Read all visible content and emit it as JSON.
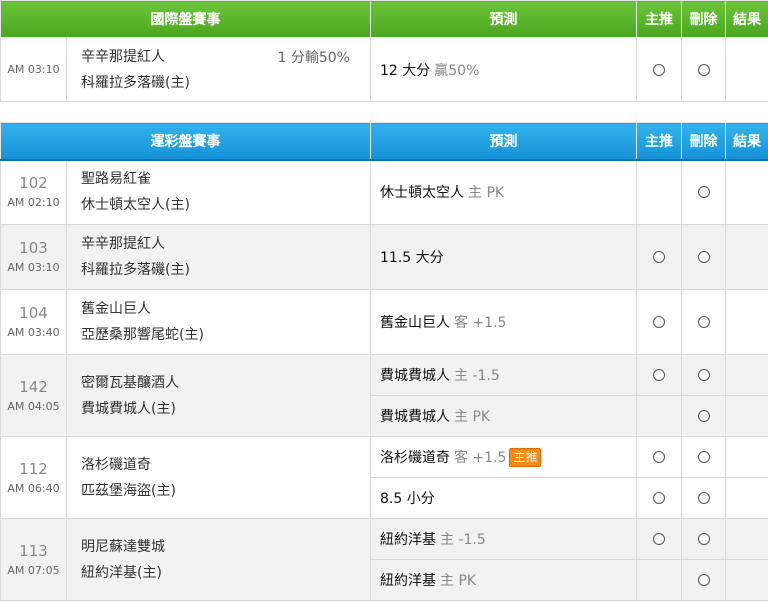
{
  "international": {
    "header": {
      "title": "國際盤賽事",
      "prediction": "預測",
      "main_pick": "主推",
      "delete": "刪除",
      "result": "結果"
    },
    "rows": [
      {
        "time": "AM 03:10",
        "home": "辛辛那提紅人",
        "away": "科羅拉多落磯(主)",
        "odds": "1 分輸50%",
        "pred_main": "12 大分",
        "pred_note": "贏50%"
      }
    ]
  },
  "lottery": {
    "header": {
      "title": "運彩盤賽事",
      "prediction": "預測",
      "main_pick": "主推",
      "delete": "刪除",
      "result": "結果"
    },
    "rows": [
      {
        "num": "102",
        "time": "AM 02:10",
        "home": "聖路易紅雀",
        "away": "休士頓太空人(主)",
        "preds": [
          {
            "main": "休士頓太空人",
            "note": "主 PK",
            "has_main_radio": false
          }
        ]
      },
      {
        "num": "103",
        "time": "AM 03:10",
        "home": "辛辛那提紅人",
        "away": "科羅拉多落磯(主)",
        "preds": [
          {
            "main": "11.5 大分",
            "note": "",
            "has_main_radio": true
          }
        ]
      },
      {
        "num": "104",
        "time": "AM 03:40",
        "home": "舊金山巨人",
        "away": "亞歷桑那響尾蛇(主)",
        "preds": [
          {
            "main": "舊金山巨人",
            "note": "客 +1.5",
            "has_main_radio": true
          }
        ]
      },
      {
        "num": "142",
        "time": "AM 04:05",
        "home": "密爾瓦基釀酒人",
        "away": "費城費城人(主)",
        "preds": [
          {
            "main": "費城費城人",
            "note": "主 -1.5",
            "has_main_radio": true
          },
          {
            "main": "費城費城人",
            "note": "主 PK",
            "has_main_radio": false
          }
        ]
      },
      {
        "num": "112",
        "time": "AM 06:40",
        "home": "洛杉磯道奇",
        "away": "匹茲堡海盜(主)",
        "preds": [
          {
            "main": "洛杉磯道奇",
            "note": "客 +1.5",
            "badge": "主推",
            "has_main_radio": true
          },
          {
            "main": "8.5 小分",
            "note": "",
            "has_main_radio": true
          }
        ]
      },
      {
        "num": "113",
        "time": "AM 07:05",
        "home": "明尼蘇達雙城",
        "away": "紐約洋基(主)",
        "preds": [
          {
            "main": "紐約洋基",
            "note": "主 -1.5",
            "has_main_radio": true
          },
          {
            "main": "紐約洋基",
            "note": "主 PK",
            "has_main_radio": false
          }
        ]
      }
    ]
  }
}
